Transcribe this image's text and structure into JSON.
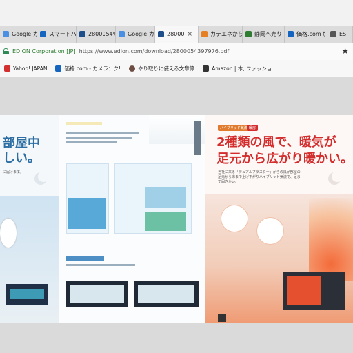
{
  "tabs": [
    {
      "title": "Google カL",
      "favicon": "#4a90e2",
      "active": false
    },
    {
      "title": "スマートハイ",
      "favicon": "#1565c0",
      "active": false
    },
    {
      "title": "2800054ﾘ",
      "favicon": "#1e4f8a",
      "active": false
    },
    {
      "title": "Google カL",
      "favicon": "#4a90e2",
      "active": false
    },
    {
      "title": "28000",
      "favicon": "#1e4f8a",
      "active": true,
      "close": "×"
    },
    {
      "title": "カテエネから",
      "favicon": "#e67e22",
      "active": false
    },
    {
      "title": "静岡へ売り",
      "favicon": "#2e7d32",
      "active": false
    },
    {
      "title": "価格.com ｶ",
      "favicon": "#1565c0",
      "active": false
    },
    {
      "title": "ES",
      "favicon": "#555555",
      "active": false
    }
  ],
  "address": {
    "org": "EDION Corporation [JP]",
    "url": "https://www.edion.com/download/2800054397976.pdf",
    "star": "★"
  },
  "bookmarks": [
    {
      "label": "Yahoo! JAPAN",
      "favicon": "#d32f2f"
    },
    {
      "label": "価格.com - カメラ：ク!",
      "favicon": "#1565c0"
    },
    {
      "label": "やり取りに使える文章停",
      "favicon": "#6d4c41"
    },
    {
      "label": "Amazon | 本, ファッショ",
      "favicon": "#333333"
    }
  ],
  "brochure": {
    "left_heading_1": "部屋中",
    "left_heading_2": "しい。",
    "left_small": "に届けます。",
    "right_tag_1": "ハイブリッド気流",
    "right_tag_2": "暖房",
    "right_heading_1": "2種類の風で、暖気が",
    "right_heading_2": "足元から広がり暖かい。",
    "right_body": "当社に来る「デュアルブラスター」からの風が部屋の足元から床まで上げ下がりハイブリッド気流で、足まで届きかい。"
  },
  "colors": {
    "accent_blue": "#2c6ea3",
    "accent_red": "#d32d2d"
  }
}
